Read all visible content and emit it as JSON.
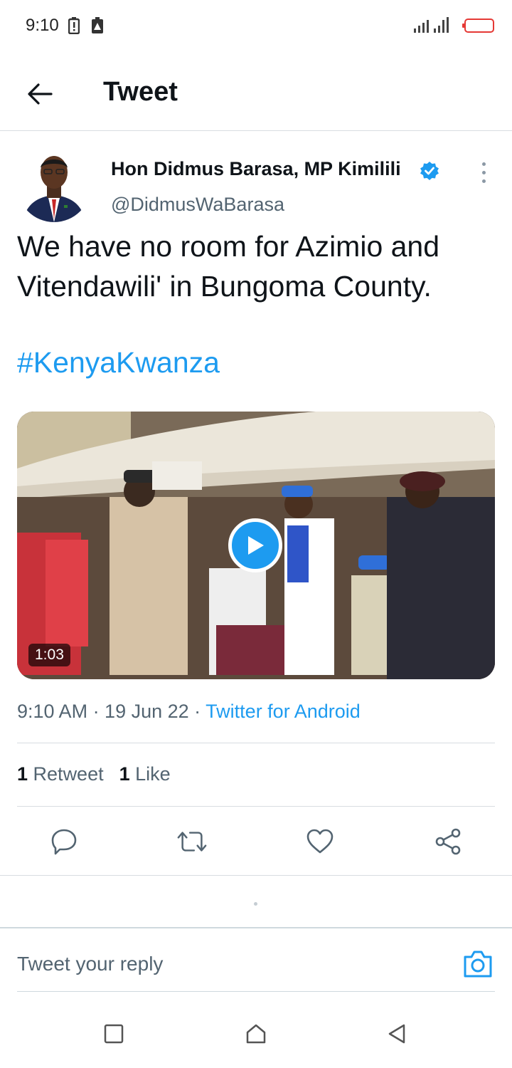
{
  "status_bar": {
    "time": "9:10"
  },
  "header": {
    "title": "Tweet"
  },
  "tweet": {
    "author_name": "Hon Didmus Barasa, MP Kimilili",
    "author_handle": "@DidmusWaBarasa",
    "text": "We have no room for Azimio and Vitendawili' in Bungoma County.",
    "hashtag": "#KenyaKwanza",
    "video_duration": "1:03",
    "timestamp": "9:10 AM · 19 Jun 22 · ",
    "source": "Twitter for Android",
    "retweet_count": "1",
    "retweet_label": "Retweet",
    "like_count": "1",
    "like_label": "Like"
  },
  "reply": {
    "placeholder": "Tweet your reply"
  },
  "colors": {
    "accent": "#1d9bf0",
    "secondary_text": "#536471",
    "primary_text": "#0f1419"
  },
  "icons": {
    "back": "arrow-left-icon",
    "verified": "verified-badge-icon",
    "more": "more-vertical-icon",
    "play": "play-icon",
    "reply": "reply-icon",
    "retweet": "retweet-icon",
    "like": "heart-icon",
    "share": "share-icon",
    "camera": "camera-icon"
  }
}
